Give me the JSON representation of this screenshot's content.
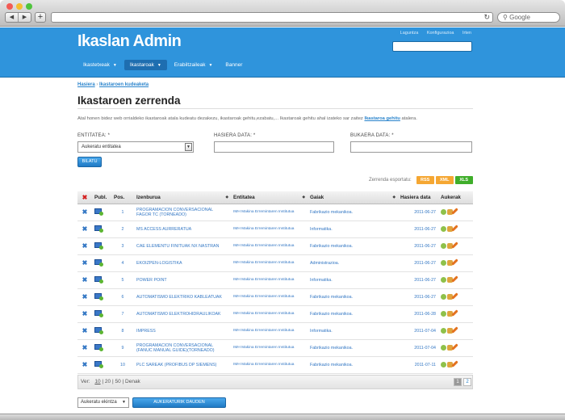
{
  "browser": {
    "search_placeholder": "Google",
    "traffic_lights": [
      "#f35b55",
      "#f5bd2f",
      "#4fc43c"
    ]
  },
  "header": {
    "brand": "Ikaslan Admin",
    "top_links": [
      "Laguntza",
      "Konfigurazioa",
      "Irten"
    ],
    "nav": [
      {
        "label": "Ikastetxeak",
        "active": false,
        "caret": true
      },
      {
        "label": "Ikastaroak",
        "active": true,
        "caret": true
      },
      {
        "label": "Erabiltzaileak",
        "active": false,
        "caret": true
      },
      {
        "label": "Banner",
        "active": false,
        "caret": false
      }
    ]
  },
  "breadcrumb": {
    "home": "Hasiera",
    "sep": "›",
    "current": "Ikastaroen kudeaketa"
  },
  "page": {
    "title": "Ikastaroen zerrenda",
    "intro_before": "Atal honen bidez web orrialdeko ikastaroak atala kudeatu dezakezu, ikastaroak gehitu,ezabatu,... Ikastaroak gehitu ahal izateko sar zaitez",
    "intro_link": "Ikastaroa gehitu",
    "intro_after": "atalera."
  },
  "filters": {
    "entitatea_label": "ENTITATEA: *",
    "entitatea_value": "Aukeratu entitatea",
    "hasiera_label": "HASIERA DATA: *",
    "bukaera_label": "BUKAERA DATA: *",
    "submit": "BILATU"
  },
  "export": {
    "label": "Zerrenda esportatu:",
    "buttons": [
      {
        "label": "RSS",
        "color": "#f5a733"
      },
      {
        "label": "XML",
        "color": "#f5a733"
      },
      {
        "label": "XLS",
        "color": "#3fae2a"
      }
    ]
  },
  "table": {
    "headers": [
      "Publ.",
      "Pos.",
      "Izenburua",
      "Entitatea",
      "Gaiak",
      "Hasiera data",
      "Aukerak"
    ],
    "rows": [
      {
        "pos": "1",
        "title": "PROGRAMACION CONVERSACIONAL FAGOR TC (TORNEADO)",
        "entity": "IMH Makina Erremintaren Institutua",
        "topic": "Fabrikazio mekanikoa.",
        "date": "2011-06-27"
      },
      {
        "pos": "2",
        "title": "MS ACCESS AURRERATUA",
        "entity": "IMH Makina Erremintaren Institutua",
        "topic": "Informatika.",
        "date": "2011-06-27"
      },
      {
        "pos": "3",
        "title": "CAE ELEMENTU FINITUAK NX NASTRAN",
        "entity": "IMH Makina Erremintaren Institutua",
        "topic": "Fabrikazio mekanikoa.",
        "date": "2011-06-27"
      },
      {
        "pos": "4",
        "title": "EKOIZPEN-LOGISTIKA",
        "entity": "IMH Makina Erremintaren Institutua",
        "topic": "Administrazioa.",
        "date": "2011-06-27"
      },
      {
        "pos": "5",
        "title": "POWER POINT",
        "entity": "IMH Makina Erremintaren Institutua",
        "topic": "Informatika.",
        "date": "2011-06-27"
      },
      {
        "pos": "6",
        "title": "AUTOMATISMO ELEKTRIKO KABLEATUAK",
        "entity": "IMH Makina Erremintaren Institutua",
        "topic": "Fabrikazio mekanikoa.",
        "date": "2011-06-27"
      },
      {
        "pos": "7",
        "title": "AUTOMATISMO ELEKTROHIDRAULIKOAK",
        "entity": "IMH Makina Erremintaren Institutua",
        "topic": "Fabrikazio mekanikoa.",
        "date": "2011-06-28"
      },
      {
        "pos": "8",
        "title": "IMPRESS",
        "entity": "IMH Makina Erremintaren Institutua",
        "topic": "Informatika.",
        "date": "2011-07-04"
      },
      {
        "pos": "9",
        "title": "PROGRAMACION CONVERSACIONAL (FANUC MANUAL GUIDE)(TORNEADO)",
        "entity": "IMH Makina Erremintaren Institutua",
        "topic": "Fabrikazio mekanikoa.",
        "date": "2011-07-04"
      },
      {
        "pos": "10",
        "title": "PLC SAREAK (PROFIBUS DP SIEMENS)",
        "entity": "IMH Makina Erremintaren Institutua",
        "topic": "Fabrikazio mekanikoa.",
        "date": "2011-07-11"
      }
    ]
  },
  "pager": {
    "label": "Ver:",
    "sizes": [
      "10",
      "20",
      "50",
      "Denak"
    ],
    "selected": "10",
    "pages": [
      "1",
      "2"
    ],
    "current_page": "1"
  },
  "bulk": {
    "select_value": "Aukeratu ekintza",
    "button": "AUKERATURIK DAUDEN ELEMENTUENTZAT"
  }
}
